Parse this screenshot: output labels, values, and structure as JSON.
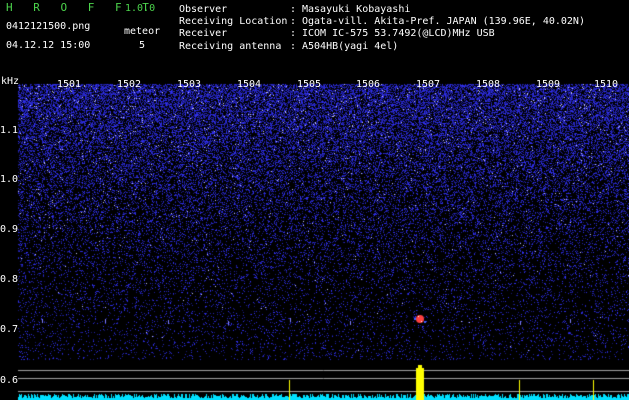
{
  "header": {
    "app_title": "H R O F F T",
    "version": "1.0.0",
    "filename": "0412121500.png",
    "datetime": "04.12.12 15:00",
    "meteor_label": "meteor",
    "meteor_count": "5"
  },
  "info": [
    {
      "label": "Observer",
      "sep": ":",
      "value": "Masayuki Kobayashi"
    },
    {
      "label": "Receiving Location",
      "sep": ":",
      "value": "Ogata-vill. Akita-Pref. JAPAN (139.96E, 40.02N)"
    },
    {
      "label": "Receiver",
      "sep": ":",
      "value": "ICOM IC-575 53.7492(@LCD)MHz USB"
    },
    {
      "label": "Receiving antenna",
      "sep": ":",
      "value": "A504HB(yagi 4el)"
    }
  ],
  "spectrogram": {
    "y_unit": "kHz",
    "y_ticks": [
      "1.1",
      "1.0",
      "0.9",
      "0.8",
      "0.7",
      "0.6"
    ],
    "x_ticks": [
      "1501",
      "1502",
      "1503",
      "1504",
      "1505",
      "1506",
      "1507",
      "1508",
      "1509",
      "1510"
    ],
    "colors": {
      "background": "#000000",
      "noise": "#1c1cc0",
      "signal": "#ff4040",
      "spectrum": "#00e0ff",
      "peak": "#ffff00",
      "grid": "#a0a0a0"
    }
  }
}
